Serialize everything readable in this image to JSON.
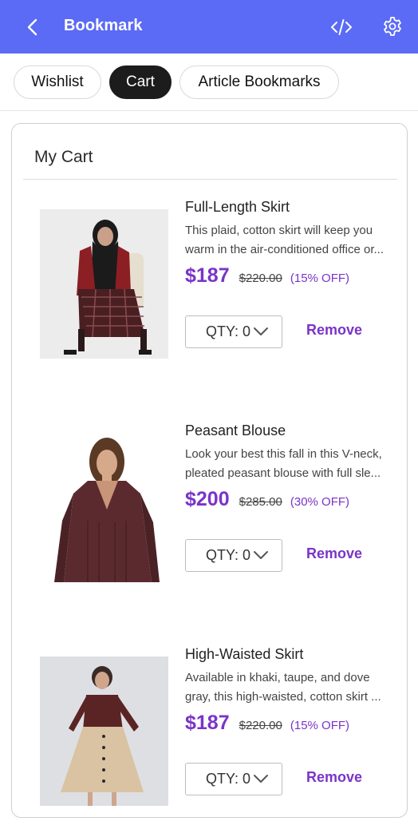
{
  "header": {
    "title": "Bookmark",
    "back_icon": "chevron-left-icon",
    "code_icon": "code-icon",
    "settings_icon": "gear-icon",
    "background_color": "#5b6bf5"
  },
  "tabs": [
    {
      "label": "Wishlist",
      "active": false
    },
    {
      "label": "Cart",
      "active": true
    },
    {
      "label": "Article Bookmarks",
      "active": false
    }
  ],
  "cart": {
    "title": "My Cart",
    "items": [
      {
        "name": "Full-Length Skirt",
        "description_line1": "This plaid, cotton skirt will keep you",
        "description_line2": "warm in the air-conditioned office or...",
        "price": "$187",
        "original_price": "$220.00",
        "discount": "(15% OFF)",
        "qty_label": "QTY: 0",
        "remove_label": "Remove"
      },
      {
        "name": "Peasant Blouse",
        "description_line1": "Look your best this fall in this V-neck,",
        "description_line2": "pleated peasant blouse with full sle...",
        "price": "$200",
        "original_price": "$285.00",
        "discount": "(30% OFF)",
        "qty_label": "QTY: 0",
        "remove_label": "Remove"
      },
      {
        "name": "High-Waisted Skirt",
        "description_line1": "Available in khaki, taupe, and dove",
        "description_line2": "gray, this high-waisted, cotton skirt ...",
        "price": "$187",
        "original_price": "$220.00",
        "discount": "(15% OFF)",
        "qty_label": "QTY: 0",
        "remove_label": "Remove"
      }
    ]
  },
  "colors": {
    "accent": "#7a34c9",
    "active_tab": "#1c1c1c"
  }
}
